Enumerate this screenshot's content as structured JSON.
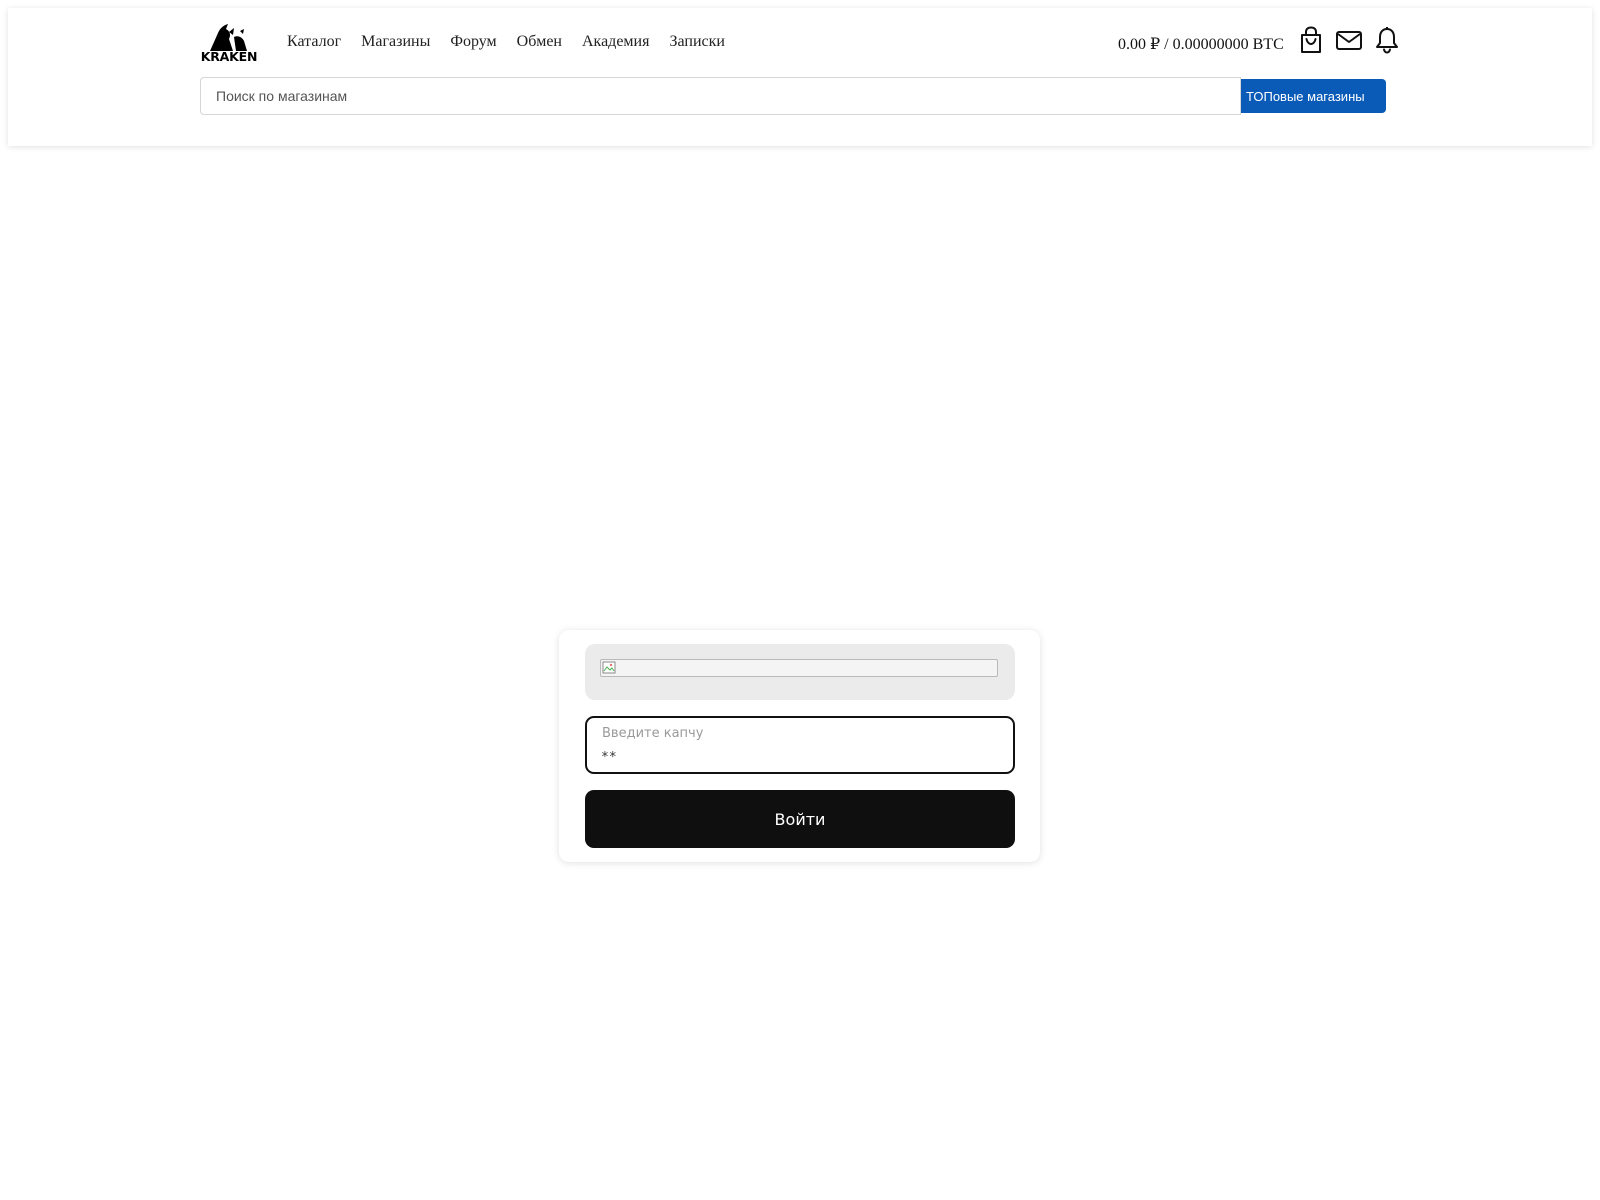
{
  "header": {
    "logo_text": "KRAKEN",
    "nav": [
      {
        "label": "Каталог"
      },
      {
        "label": "Магазины"
      },
      {
        "label": "Форум"
      },
      {
        "label": "Обмен"
      },
      {
        "label": "Академия"
      },
      {
        "label": "Записки"
      }
    ],
    "balance": "0.00 ₽ / 0.00000000 BTC",
    "icons": [
      "shopping-bag-icon",
      "mail-icon",
      "bell-icon"
    ],
    "search": {
      "placeholder": "Поиск по магазинам",
      "value": ""
    },
    "top_button_label": "ТОПовые магазины"
  },
  "login": {
    "captcha_label": "Введите капчу",
    "captcha_value": "**",
    "submit_label": "Войти"
  },
  "colors": {
    "accent": "#0a5ab8",
    "button_dark": "#0f0f0f"
  }
}
